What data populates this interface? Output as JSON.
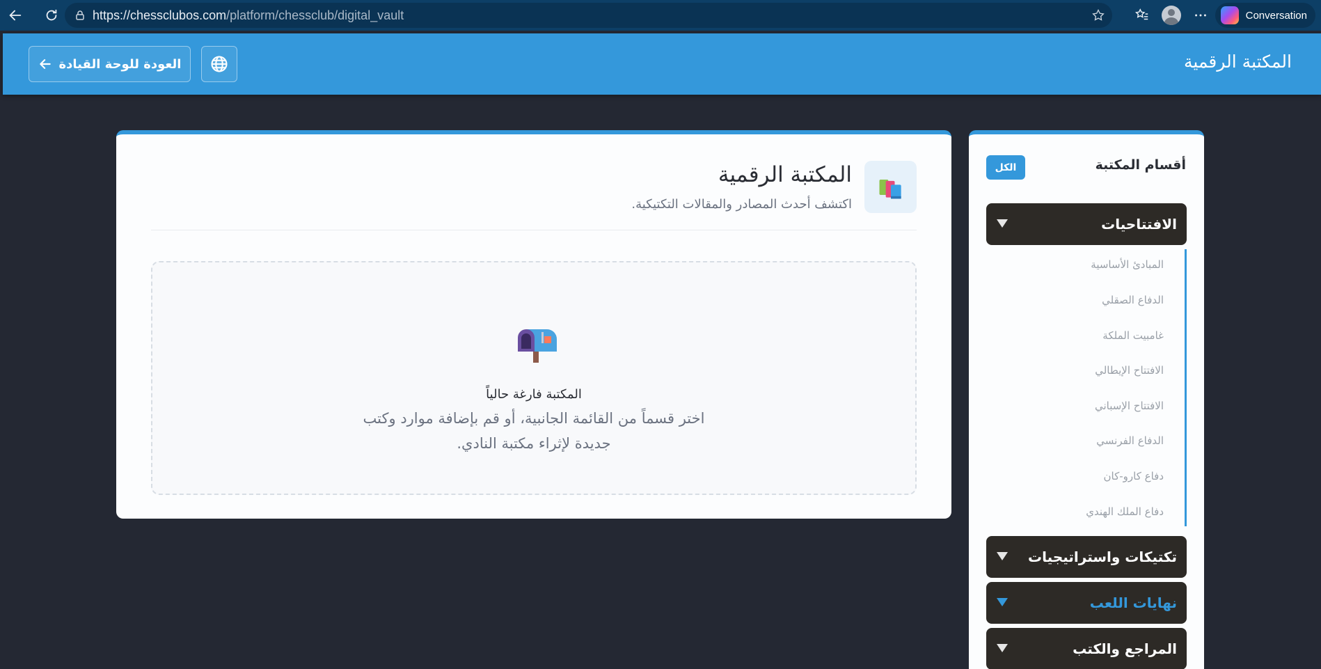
{
  "browser": {
    "url_host": "https://chessclubos.com",
    "url_path": "/platform/chessclub/digital_vault",
    "conversation_label": "Conversation"
  },
  "header": {
    "title": "المكتبة الرقمية",
    "back_label": "العودة للوحة القيادة"
  },
  "main": {
    "title": "المكتبة الرقمية",
    "subtitle": "اكتشف أحدث المصادر والمقالات التكتيكية.",
    "empty_title": "المكتبة فارغة حالياً",
    "empty_desc": "اختر قسماً من القائمة الجانبية، أو قم بإضافة موارد وكتب جديدة لإثراء مكتبة النادي."
  },
  "sidebar": {
    "title": "أقسام المكتبة",
    "all_label": "الكل",
    "categories": [
      {
        "label": "الافتتاحيات",
        "items": [
          "المبادئ الأساسية",
          "الدفاع الصقلي",
          "غامبيت الملكة",
          "الافتتاح الإيطالي",
          "الافتتاح الإسباني",
          "الدفاع الفرنسي",
          "دفاع كارو-كان",
          "دفاع الملك الهندي"
        ]
      },
      {
        "label": "تكتيكات واستراتيجيات"
      },
      {
        "label": "نهايات اللعب"
      },
      {
        "label": "المراجع والكتب"
      }
    ]
  },
  "colors": {
    "accent": "#3498db",
    "background": "#242833",
    "category_bg": "#2d2a26"
  }
}
